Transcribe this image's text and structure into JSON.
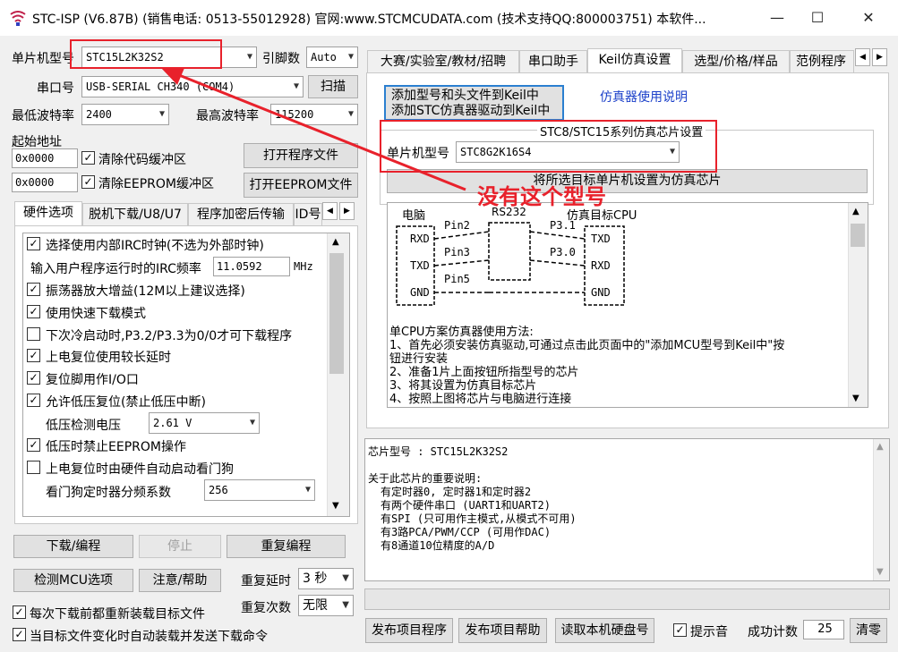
{
  "title": "STC-ISP (V6.87B) (销售电话: 0513-55012928) 官网:www.STCMCUDATA.com  (技术支持QQ:800003751) 本软件...",
  "window_controls": {
    "minimize": "—",
    "maximize": "☐",
    "close": "✕"
  },
  "left": {
    "mcu_label": "单片机型号",
    "mcu_value": "STC15L2K32S2",
    "pins_label": "引脚数",
    "pins_value": "Auto",
    "port_label": "串口号",
    "port_value": "USB-SERIAL CH340 (COM4)",
    "scan_button": "扫描",
    "min_baud_label": "最低波特率",
    "min_baud_value": "2400",
    "max_baud_label": "最高波特率",
    "max_baud_value": "115200",
    "start_addr_label": "起始地址",
    "addr1": "0x0000",
    "clear_code_label": "清除代码缓冲区",
    "open_prog_button": "打开程序文件",
    "addr2": "0x0000",
    "clear_eeprom_label": "清除EEPROM缓冲区",
    "open_eeprom_button": "打开EEPROM文件"
  },
  "hw_tabs": [
    "硬件选项",
    "脱机下载/U8/U7",
    "程序加密后传输",
    "ID号"
  ],
  "hw_options": {
    "irc": "选择使用内部IRC时钟(不选为外部时钟)",
    "irc_freq_label": "输入用户程序运行时的IRC频率",
    "irc_freq_value": "11.0592",
    "irc_freq_unit": "MHz",
    "osc_gain": "振荡器放大增益(12M以上建议选择)",
    "fast_download": "使用快速下载模式",
    "cold_start": "下次冷启动时,P3.2/P3.3为0/0才可下载程序",
    "power_delay": "上电复位使用较长延时",
    "reset_io": "复位脚用作I/O口",
    "low_voltage_reset": "允许低压复位(禁止低压中断)",
    "lv_detect_label": "低压检测电压",
    "lv_detect_value": "2.61 V",
    "lv_eeprom": "低压时禁止EEPROM操作",
    "hw_watchdog": "上电复位时由硬件自动启动看门狗",
    "wdt_div_label": "看门狗定时器分频系数",
    "wdt_div_value": "256"
  },
  "actions": {
    "download": "下载/编程",
    "stop": "停止",
    "reprogram": "重复编程",
    "detect": "检测MCU选项",
    "help": "注意/帮助",
    "repeat_delay_label": "重复延时",
    "repeat_delay_value": "3 秒",
    "repeat_count_label": "重复次数",
    "repeat_count_value": "无限",
    "reload_label": "每次下载前都重新装载目标文件",
    "auto_send_label": "当目标文件变化时自动装载并发送下载命令"
  },
  "right_tabs": [
    "大赛/实验室/教材/招聘",
    "串口助手",
    "Keil仿真设置",
    "选型/价格/样品",
    "范例程序"
  ],
  "keil": {
    "add_btn_line1": "添加型号和头文件到Keil中",
    "add_btn_line2": "添加STC仿真器驱动到Keil中",
    "manual_link": "仿真器使用说明",
    "group_title": "STC8/STC15系列仿真芯片设置",
    "mcu_label": "单片机型号",
    "mcu_value": "STC8G2K16S4",
    "set_button": "将所选目标单片机设置为仿真芯片",
    "diagram": {
      "pc_label": "电脑",
      "rs232_label": "RS232",
      "target_label": "仿真目标CPU",
      "rxd": "RXD",
      "txd": "TXD",
      "gnd": "GND",
      "pin2": "Pin2",
      "pin3": "Pin3",
      "pin5": "Pin5",
      "p31": "P3.1",
      "p30": "P3.0",
      "t_txd": "TXD",
      "t_rxd": "RXD",
      "t_gnd": "GND"
    },
    "instructions": [
      "单CPU方案仿真器使用方法:",
      "1、首先必须安装仿真驱动,可通过点击此页面中的\"添加MCU型号到Keil中\"按",
      "钮进行安装",
      "2、准备1片上面按钮所指型号的芯片",
      "3、将其设置为仿真目标芯片",
      "4、按照上图将芯片与电脑进行连接"
    ]
  },
  "annotation": "没有这个型号",
  "info": {
    "lines": [
      "芯片型号 : STC15L2K32S2",
      "",
      "关于此芯片的重要说明:",
      "  有定时器0, 定时器1和定时器2",
      "  有两个硬件串口 (UART1和UART2)",
      "  有SPI (只可用作主模式,从模式不可用)",
      "  有3路PCA/PWM/CCP (可用作DAC)",
      "  有8通道10位精度的A/D"
    ]
  },
  "bottom": {
    "publish_program": "发布项目程序",
    "publish_help": "发布项目帮助",
    "read_disk": "读取本机硬盘号",
    "sound_label": "提示音",
    "success_label": "成功计数",
    "success_value": "25",
    "clear_button": "清零"
  },
  "colors": {
    "red": "#e8212b",
    "link": "#1a3fc9"
  }
}
